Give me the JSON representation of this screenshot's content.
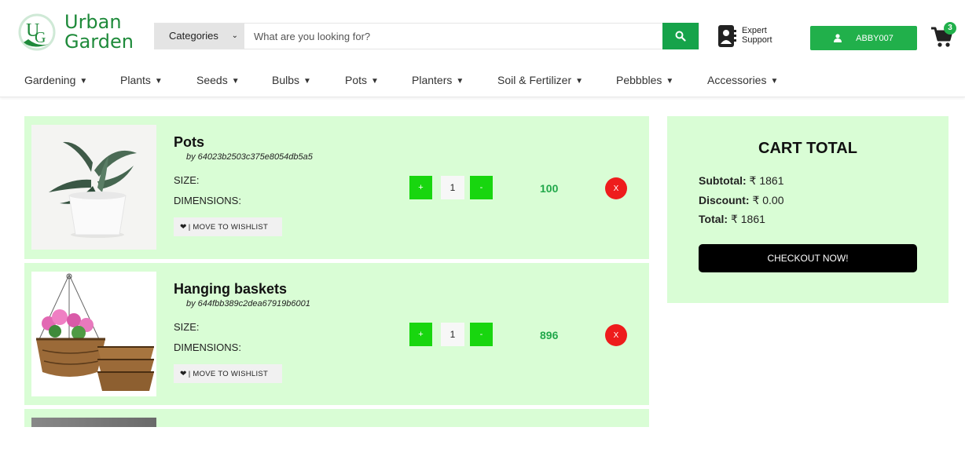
{
  "brand": {
    "line1": "Urban",
    "line2": "Garden",
    "color": "#1e8a3a"
  },
  "search": {
    "category_label": "Categories",
    "placeholder": "What are you looking for?",
    "icon": "search-icon"
  },
  "support": {
    "line1": "Expert",
    "line2": "Support",
    "icon": "support-icon"
  },
  "user": {
    "name": "ABBY007",
    "icon": "user-icon"
  },
  "cart": {
    "count": "3",
    "icon": "cart-icon"
  },
  "nav": {
    "items": [
      {
        "label": "Gardening"
      },
      {
        "label": "Plants"
      },
      {
        "label": "Seeds"
      },
      {
        "label": "Bulbs"
      },
      {
        "label": "Pots"
      },
      {
        "label": "Planters"
      },
      {
        "label": "Soil & Fertilizer"
      },
      {
        "label": "Pebbbles"
      },
      {
        "label": "Accessories"
      }
    ]
  },
  "items": [
    {
      "title": "Pots",
      "by": "by 64023b2503c375e8054db5a5",
      "size_label": "SIZE:",
      "dim_label": "DIMENSIONS:",
      "wishlist_label": "| MOVE TO WISHLIST",
      "qty": "1",
      "plus": "+",
      "minus": "-",
      "price": "100",
      "remove": "X"
    },
    {
      "title": "Hanging baskets",
      "by": "by 644fbb389c2dea67919b6001",
      "size_label": "SIZE:",
      "dim_label": "DIMENSIONS:",
      "wishlist_label": "| MOVE TO WISHLIST",
      "qty": "1",
      "plus": "+",
      "minus": "-",
      "price": "896",
      "remove": "X"
    }
  ],
  "summary": {
    "title": "CART TOTAL",
    "subtotal_label": "Subtotal:",
    "subtotal_value": "₹ 1861",
    "discount_label": "Discount:",
    "discount_value": "₹ 0.00",
    "total_label": "Total:",
    "total_value": "₹ 1861",
    "checkout_label": "CHECKOUT NOW!"
  },
  "colors": {
    "accent": "#21b04b",
    "panel": "#d9fdd5",
    "qty_button": "#18d60f",
    "remove": "#ee1c1c"
  }
}
